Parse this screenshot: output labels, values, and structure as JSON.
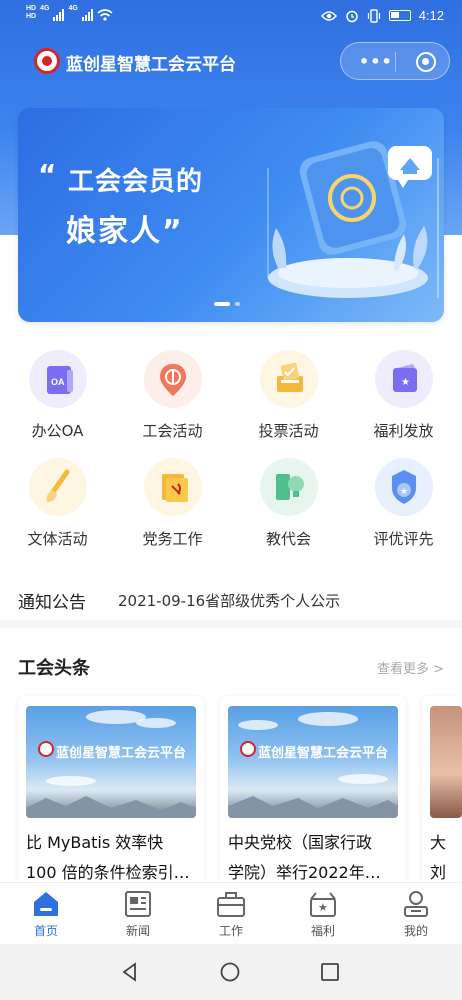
{
  "status_bar": {
    "network": "4G",
    "network2": "4G",
    "hd1": "HD",
    "hd2": "HD",
    "time": "4:12"
  },
  "app_bar": {
    "title": "蓝创星智慧工会云平台",
    "more_icon": "more-dots-icon",
    "close_icon": "target-icon"
  },
  "banner": {
    "quote_open": "“",
    "line1": "工会会员的",
    "line2": "娘家人”",
    "active_slide": 1,
    "slide_count": 2
  },
  "grid": [
    {
      "label": "办公OA",
      "icon": "oa-book-icon",
      "color": "#7b6cf0"
    },
    {
      "label": "工会活动",
      "icon": "union-pin-icon",
      "color": "#f2765a"
    },
    {
      "label": "投票活动",
      "icon": "ballot-box-icon",
      "color": "#f5b83a"
    },
    {
      "label": "福利发放",
      "icon": "gift-card-icon",
      "color": "#7b6cf0"
    },
    {
      "label": "文体活动",
      "icon": "brush-icon",
      "color": "#f5b83a"
    },
    {
      "label": "党务工作",
      "icon": "party-flag-icon",
      "color": "#f5b83a"
    },
    {
      "label": "教代会",
      "icon": "lightbulb-icon",
      "color": "#4fc08d"
    },
    {
      "label": "评优评先",
      "icon": "medal-icon",
      "color": "#5b8ff0"
    }
  ],
  "notice": {
    "title": "通知公告",
    "text": "2021-09-16省部级优秀个人公示"
  },
  "news": {
    "title": "工会头条",
    "see_more": "查看更多 >",
    "cards": [
      {
        "image_caption": "蓝创星智慧工会云平台",
        "title_line1": "比 MyBatis 效率快",
        "title_line2": "100 倍的条件检索引…"
      },
      {
        "image_caption": "蓝创星智慧工会云平台",
        "title_line1": "中央党校（国家行政",
        "title_line2": "学院）举行2022年…"
      },
      {
        "image_caption": "",
        "title_line1": "大",
        "title_line2": "刘"
      }
    ]
  },
  "tabbar": [
    {
      "label": "首页",
      "icon": "home-icon",
      "active": true
    },
    {
      "label": "新闻",
      "icon": "news-icon",
      "active": false
    },
    {
      "label": "工作",
      "icon": "briefcase-icon",
      "active": false
    },
    {
      "label": "福利",
      "icon": "gift-box-icon",
      "active": false
    },
    {
      "label": "我的",
      "icon": "user-icon",
      "active": false
    }
  ],
  "colors": {
    "primary": "#2f6fe0",
    "header_gradient_end": "#6aa6f5",
    "logo_red": "#d6242b"
  }
}
